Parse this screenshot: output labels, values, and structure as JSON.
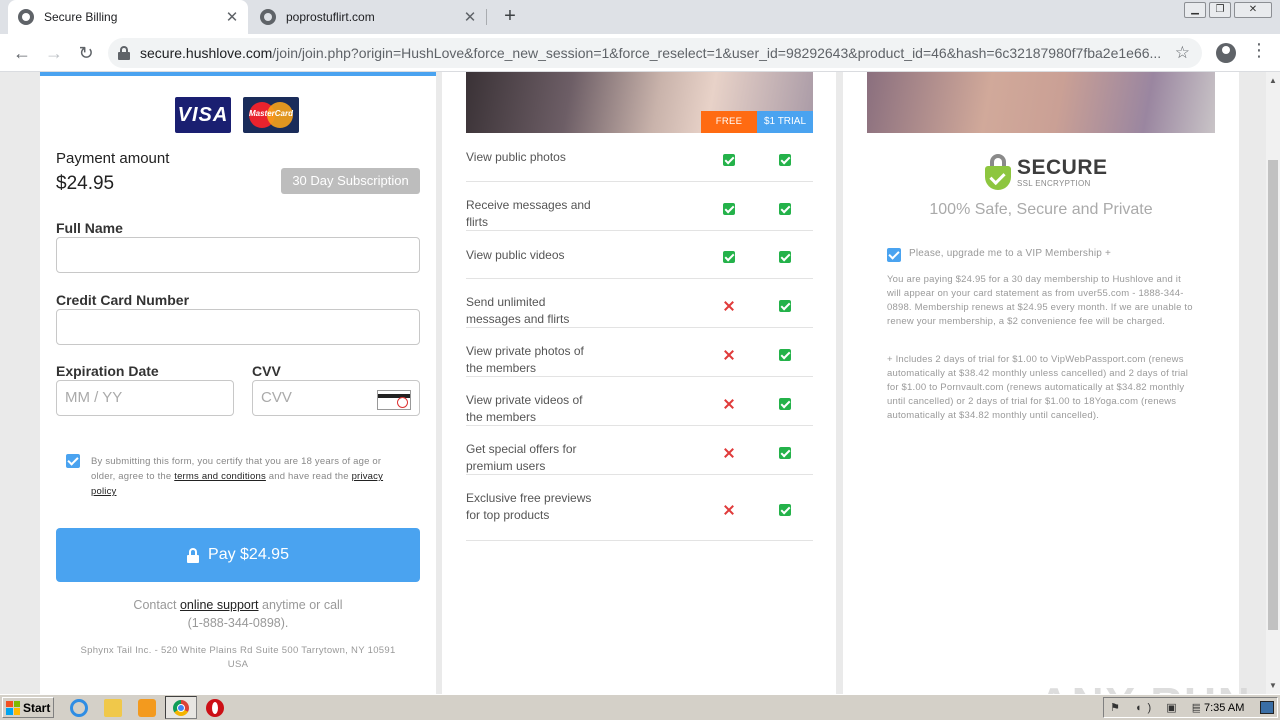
{
  "browser": {
    "tabs": [
      {
        "title": "Secure Billing",
        "active": true
      },
      {
        "title": "poprostuflirt.com",
        "active": false
      }
    ],
    "new_tab": "+",
    "window_controls": {
      "minimize": "▁",
      "maximize": "❐",
      "close": "✕"
    },
    "url_host": "secure.hushlove.com",
    "url_path": "/join/join.php?origin=HushLove&force_new_session=1&force_reselect=1&user_id=98292643&product_id=46&hash=6c32187980f7fba2e1e66...",
    "icons": {
      "back": "arrow-left-icon",
      "forward": "arrow-right-icon",
      "reload": "reload-icon",
      "star": "star-icon",
      "account": "account-icon",
      "menu": "kebab-menu-icon"
    }
  },
  "payment": {
    "cards": {
      "visa": "VISA",
      "mastercard": "MasterCard"
    },
    "amount_label": "Payment amount",
    "amount": "$24.95",
    "subscription_badge": "30 Day Subscription",
    "full_name_label": "Full Name",
    "full_name_value": "",
    "card_number_label": "Credit Card Number",
    "card_number_value": "",
    "expiration_label": "Expiration Date",
    "expiration_placeholder": "MM / YY",
    "cvv_label": "CVV",
    "cvv_placeholder": "CVV",
    "terms_checked": true,
    "terms_text_1": "By submitting this form, you certify that you are 18 years of age or older, agree to the ",
    "terms_link": "terms and conditions",
    "terms_text_2": " and have read the ",
    "privacy_link": "privacy policy",
    "pay_button": "Pay $24.95",
    "contact_prefix": "Contact ",
    "contact_link": "online support",
    "contact_suffix": " anytime or call",
    "contact_phone": "(1-888-344-0898).",
    "address": "Sphynx Tail Inc. - 520 White Plains Rd Suite 500 Tarrytown, NY 10591 USA"
  },
  "features": {
    "badge_free": "FREE",
    "badge_trial": "$1 TRIAL",
    "rows": [
      {
        "label": "View public photos",
        "free": true,
        "trial": true
      },
      {
        "label": "Receive messages and flirts",
        "free": true,
        "trial": true
      },
      {
        "label": "View public videos",
        "free": true,
        "trial": true
      },
      {
        "label": "Send unlimited messages and flirts",
        "free": false,
        "trial": true
      },
      {
        "label": "View private photos of the members",
        "free": false,
        "trial": true
      },
      {
        "label": "View private videos of the members",
        "free": false,
        "trial": true
      },
      {
        "label": "Get special offers for premium users",
        "free": false,
        "trial": true
      },
      {
        "label": "Exclusive free previews for top products",
        "free": false,
        "trial": true
      }
    ]
  },
  "security": {
    "secure_title": "SECURE",
    "secure_sub": "SSL ENCRYPTION",
    "safe_text": "100% Safe, Secure and Private",
    "vip_checked": true,
    "vip_label": "Please, upgrade me to a VIP Membership +",
    "notice": "You are paying $24.95 for a 30 day membership to Hushlove and it will appear on your card statement as from uver55.com - 1888-344-0898. Membership renews at $24.95 every month. If we are unable to renew your membership, a $2 convenience fee will be charged.",
    "trial_notice": "+ Includes 2 days of trial for $1.00 to VipWebPassport.com (renews automatically at $38.42 monthly unless cancelled) and 2 days of trial for $1.00 to Pornvault.com (renews automatically at $34.82 monthly until cancelled) or 2 days of trial for $1.00 to 18Yoga.com (renews automatically at $34.82 monthly until cancelled)."
  },
  "watermark": "ANY RUN",
  "taskbar": {
    "start": "Start",
    "tray_icons": "⚑ ◖) ▣ ▤ ⚐",
    "clock": "7:35 AM"
  },
  "colors": {
    "accent": "#4aa3f0",
    "free_badge": "#ff6b12",
    "check": "#24b24a",
    "cross": "#e03b3b"
  }
}
